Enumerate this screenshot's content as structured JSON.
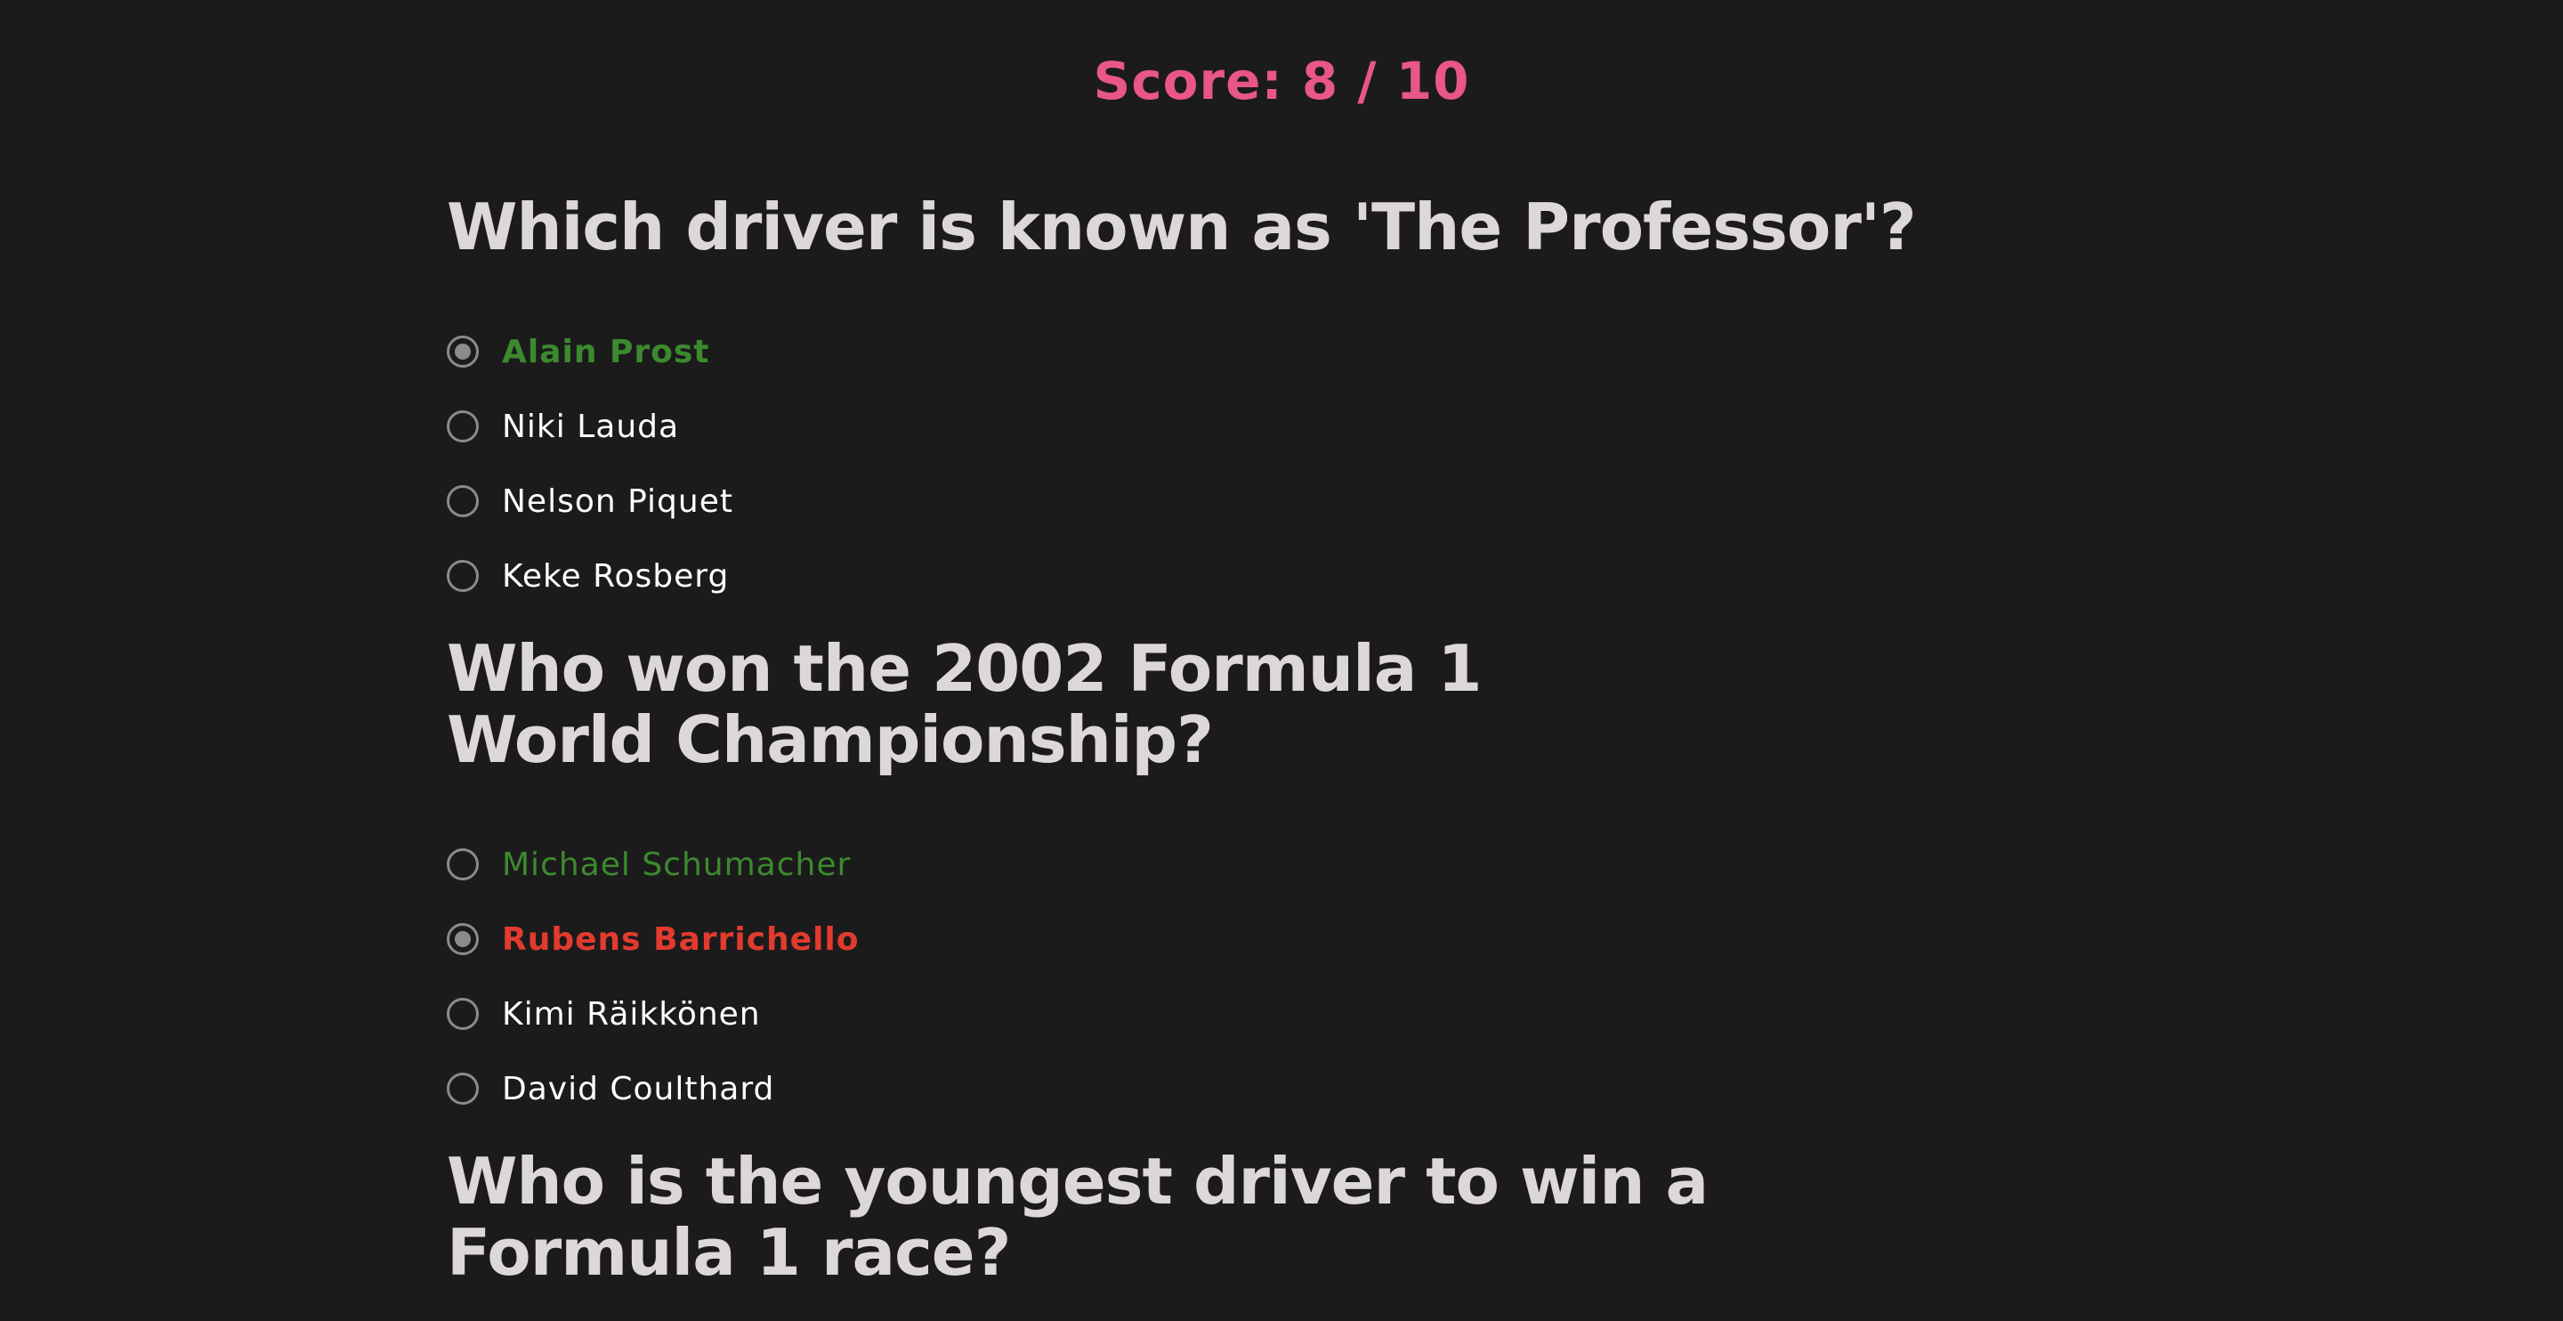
{
  "score": {
    "label": "Score: 8 / 10"
  },
  "questions": [
    {
      "title": "Which driver is known as 'The Professor'?",
      "options": [
        {
          "label": "Alain Prost",
          "state": "correct-selected"
        },
        {
          "label": "Niki Lauda",
          "state": "normal"
        },
        {
          "label": "Nelson Piquet",
          "state": "normal"
        },
        {
          "label": "Keke Rosberg",
          "state": "normal"
        }
      ]
    },
    {
      "title": "Who won the 2002 Formula 1 World Championship?",
      "options": [
        {
          "label": "Michael Schumacher",
          "state": "correct"
        },
        {
          "label": "Rubens Barrichello",
          "state": "wrong-selected"
        },
        {
          "label": "Kimi Räikkönen",
          "state": "normal"
        },
        {
          "label": "David Coulthard",
          "state": "normal"
        }
      ]
    },
    {
      "title": "Who is the youngest driver to win a Formula 1 race?"
    }
  ],
  "colors": {
    "background": "#1c1b1c",
    "score": "#e8568a",
    "question": "#ddd7d8",
    "correct": "#3c8a2e",
    "wrong": "#e23b2e",
    "option": "#ffffff"
  }
}
